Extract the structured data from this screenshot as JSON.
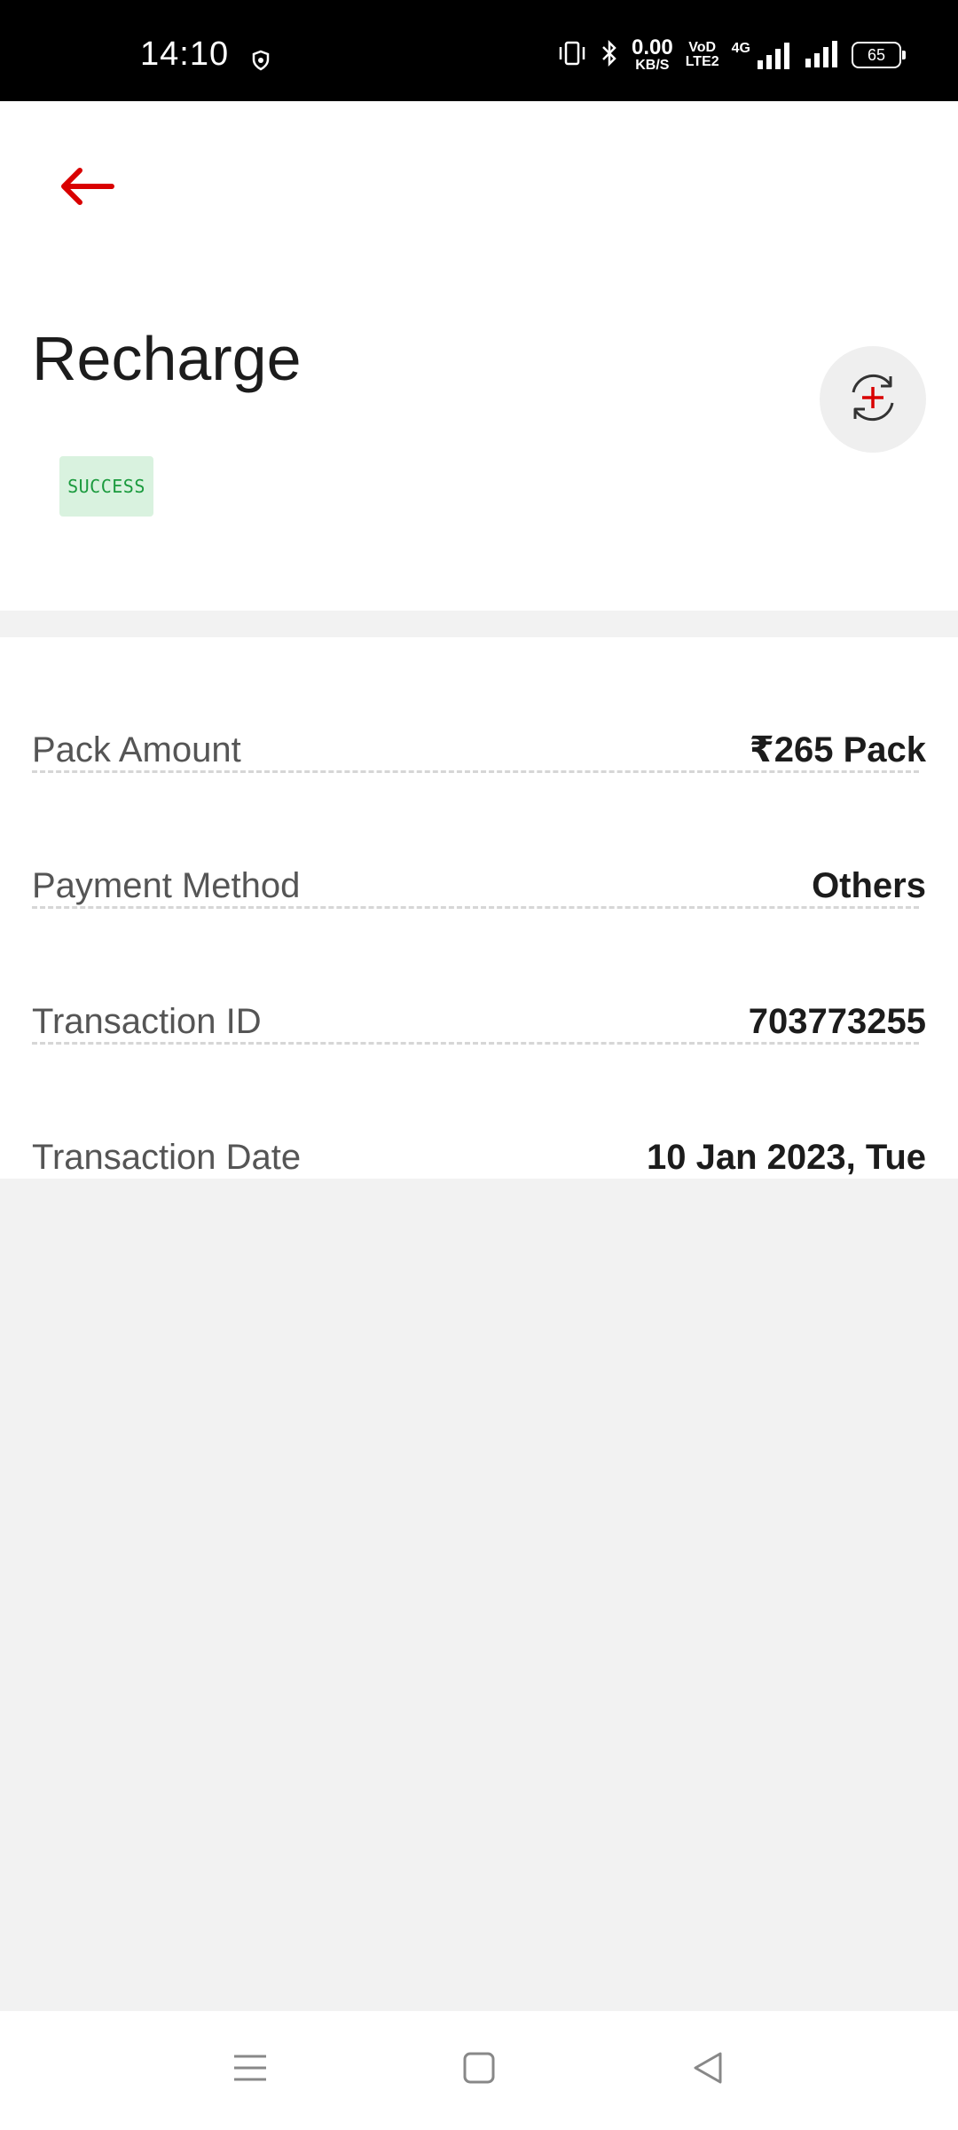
{
  "status_bar": {
    "time": "14:10",
    "net_speed_value": "0.00",
    "net_speed_unit": "KB/S",
    "volte_top": "VoD",
    "volte_bottom": "LTE2",
    "network_type": "4G",
    "battery": "65",
    "icons": [
      "shield-icon",
      "vibrate-icon",
      "bluetooth-icon",
      "signal-icon",
      "battery-icon"
    ]
  },
  "header": {
    "back_icon": "arrow-left-icon",
    "title": "Recharge",
    "status_badge": "SUCCESS",
    "repeat_icon": "refresh-plus-icon"
  },
  "details": [
    {
      "label": "Pack Amount",
      "value": "₹265 Pack"
    },
    {
      "label": "Payment Method",
      "value": "Others"
    },
    {
      "label": "Transaction ID",
      "value": "703773255"
    },
    {
      "label": "Transaction Date",
      "value": "10 Jan 2023, Tue"
    }
  ],
  "nav_bar": {
    "icons": [
      "menu-icon",
      "home-square-icon",
      "back-triangle-icon"
    ]
  },
  "colors": {
    "accent": "#d90000",
    "success_text": "#1a9a3d",
    "success_bg": "#d9f2df",
    "page_bg": "#f2f2f2"
  }
}
